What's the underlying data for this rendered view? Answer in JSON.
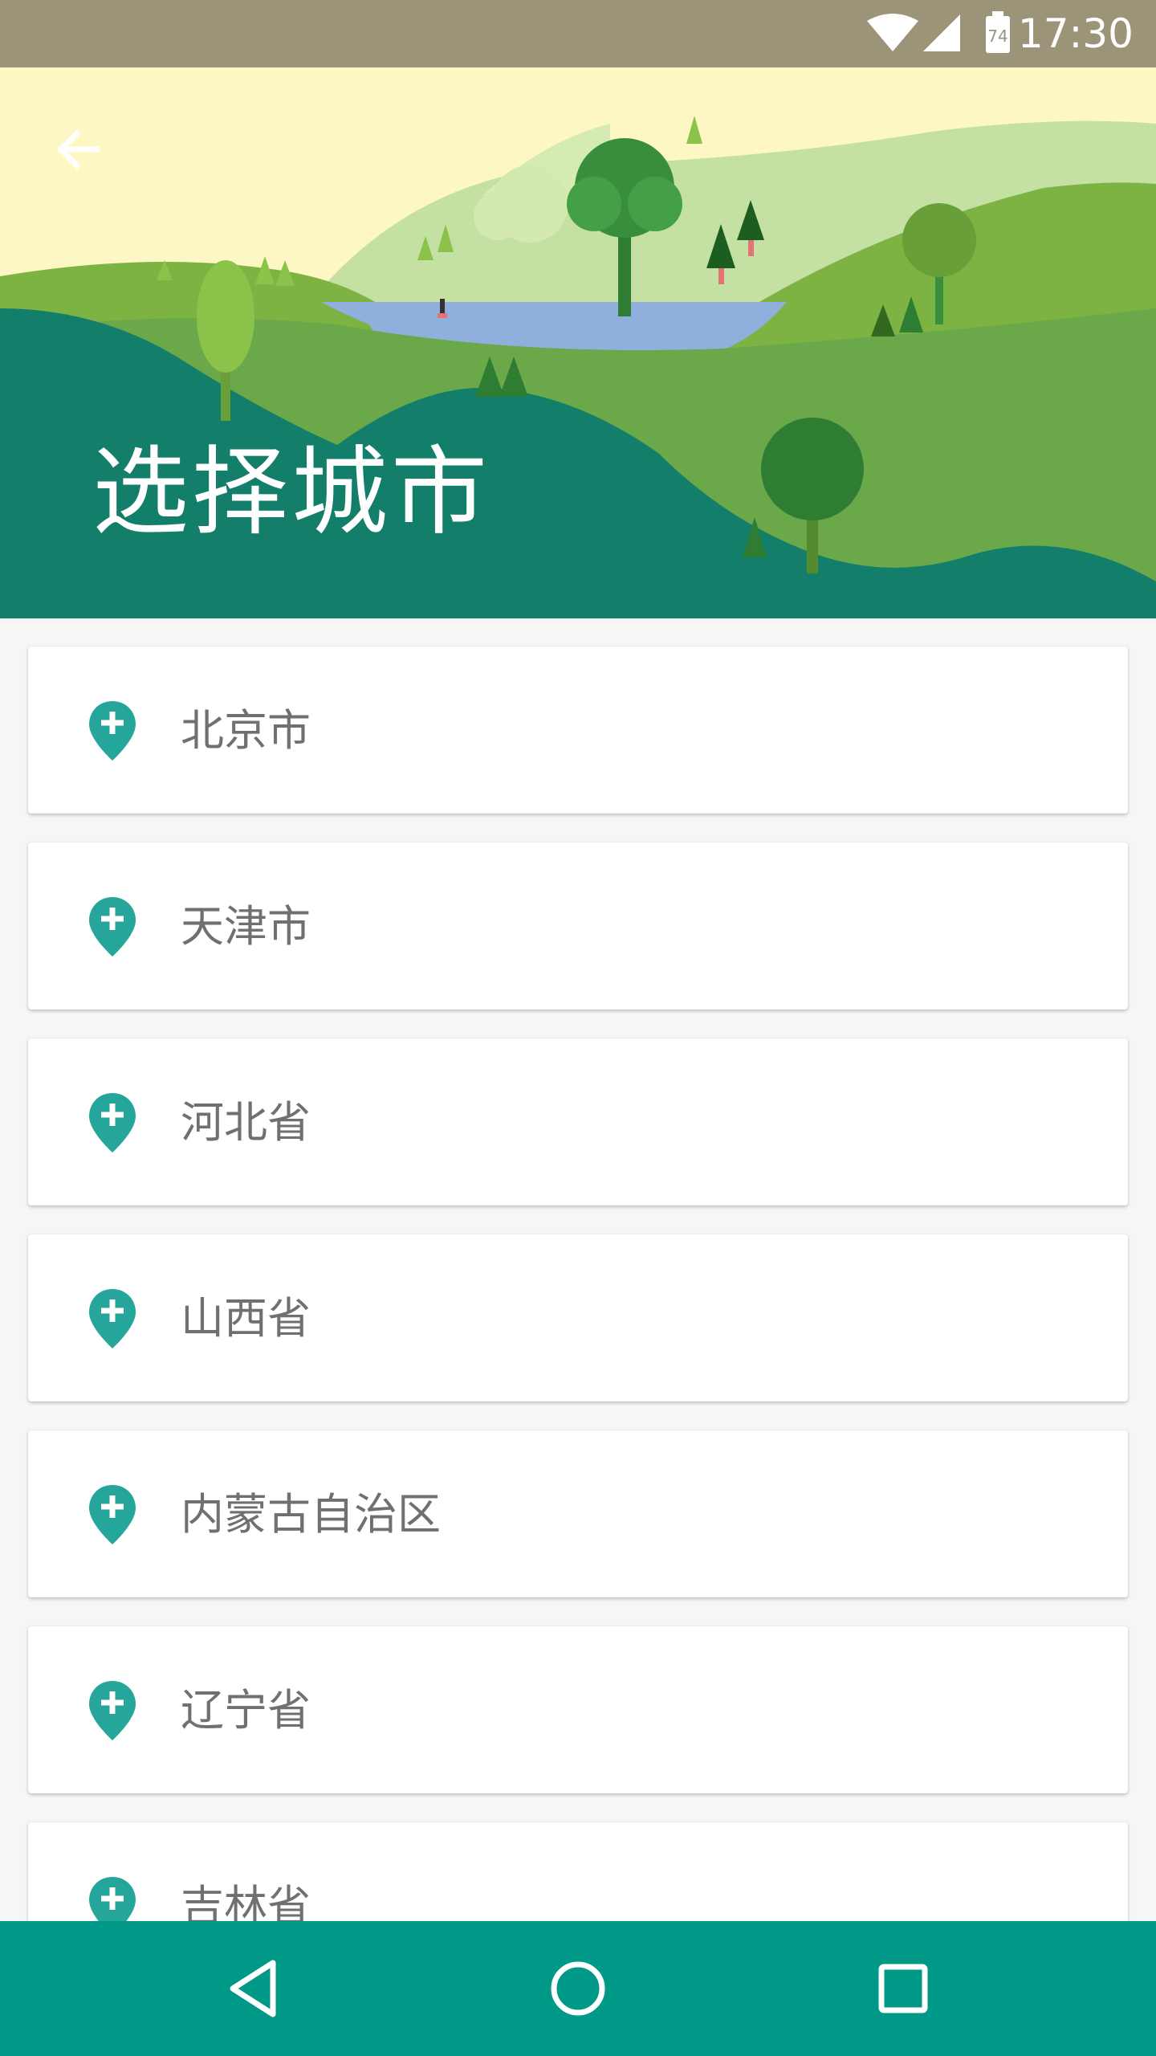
{
  "status_bar": {
    "time": "17:30",
    "battery_level": "74",
    "bar_color": "#9b9479"
  },
  "header": {
    "title": "选择城市",
    "back_icon": "arrow-left-icon"
  },
  "colors": {
    "accent": "#26a69a",
    "nav_bar": "#009886",
    "card_text": "#707070"
  },
  "cities": [
    {
      "name": "北京市",
      "icon": "location-plus-icon"
    },
    {
      "name": "天津市",
      "icon": "location-plus-icon"
    },
    {
      "name": "河北省",
      "icon": "location-plus-icon"
    },
    {
      "name": "山西省",
      "icon": "location-plus-icon"
    },
    {
      "name": "内蒙古自治区",
      "icon": "location-plus-icon"
    },
    {
      "name": "辽宁省",
      "icon": "location-plus-icon"
    },
    {
      "name": "吉林省",
      "icon": "location-plus-icon"
    }
  ],
  "nav_bar": {
    "back_icon": "triangle-back-icon",
    "home_icon": "circle-home-icon",
    "recents_icon": "square-recents-icon"
  }
}
